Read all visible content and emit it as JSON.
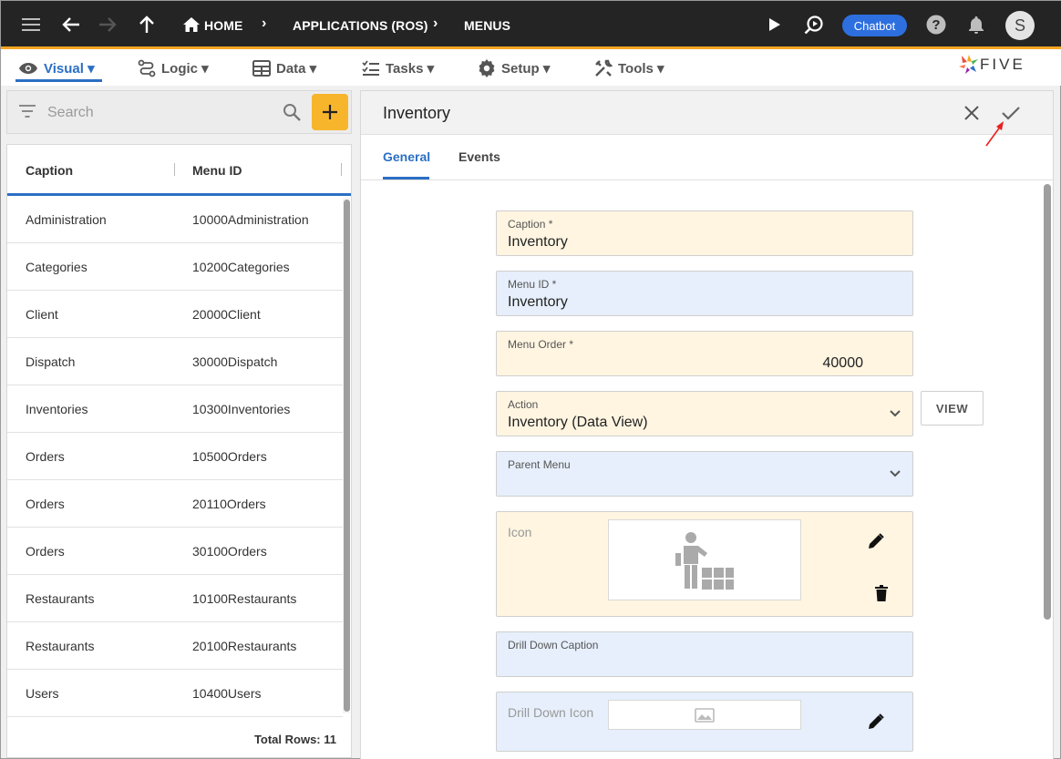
{
  "topbar": {
    "breadcrumbs": [
      "HOME",
      "APPLICATIONS (ROS)",
      "MENUS"
    ],
    "chatbot_label": "Chatbot",
    "avatar_initial": "S"
  },
  "menubar": {
    "items": [
      {
        "label": "Visual",
        "icon": "eye-icon",
        "active": true
      },
      {
        "label": "Logic",
        "icon": "logic-icon"
      },
      {
        "label": "Data",
        "icon": "table-icon"
      },
      {
        "label": "Tasks",
        "icon": "tasks-icon"
      },
      {
        "label": "Setup",
        "icon": "gear-icon"
      },
      {
        "label": "Tools",
        "icon": "tools-icon"
      }
    ],
    "logo_text": "FIVE"
  },
  "list": {
    "search_placeholder": "Search",
    "columns": [
      "Caption",
      "Menu ID"
    ],
    "rows": [
      [
        "Administration",
        "10000Administration"
      ],
      [
        "Categories",
        "10200Categories"
      ],
      [
        "Client",
        "20000Client"
      ],
      [
        "Dispatch",
        "30000Dispatch"
      ],
      [
        "Inventories",
        "10300Inventories"
      ],
      [
        "Orders",
        "10500Orders"
      ],
      [
        "Orders",
        "20110Orders"
      ],
      [
        "Orders",
        "30100Orders"
      ],
      [
        "Restaurants",
        "10100Restaurants"
      ],
      [
        "Restaurants",
        "20100Restaurants"
      ],
      [
        "Users",
        "10400Users"
      ]
    ],
    "total_rows": "Total Rows: 11"
  },
  "detail": {
    "title": "Inventory",
    "tabs": [
      "General",
      "Events"
    ],
    "active_tab": "General",
    "fields": {
      "caption": {
        "label": "Caption *",
        "value": "Inventory"
      },
      "menu_id": {
        "label": "Menu ID *",
        "value": "Inventory"
      },
      "menu_order": {
        "label": "Menu Order *",
        "value": "40000"
      },
      "action": {
        "label": "Action",
        "value": "Inventory (Data View)"
      },
      "parent_menu": {
        "label": "Parent Menu",
        "value": ""
      },
      "icon": {
        "label": "Icon"
      },
      "drill_down_caption": {
        "label": "Drill Down Caption",
        "value": ""
      },
      "drill_down_icon": {
        "label": "Drill Down Icon"
      }
    },
    "view_label": "VIEW"
  },
  "colors": {
    "topbar": "#242424",
    "accent": "#2b6fc4",
    "add_button": "#f7b52c",
    "field_yellow": "#fff5e1",
    "field_blue": "#e6effb"
  }
}
